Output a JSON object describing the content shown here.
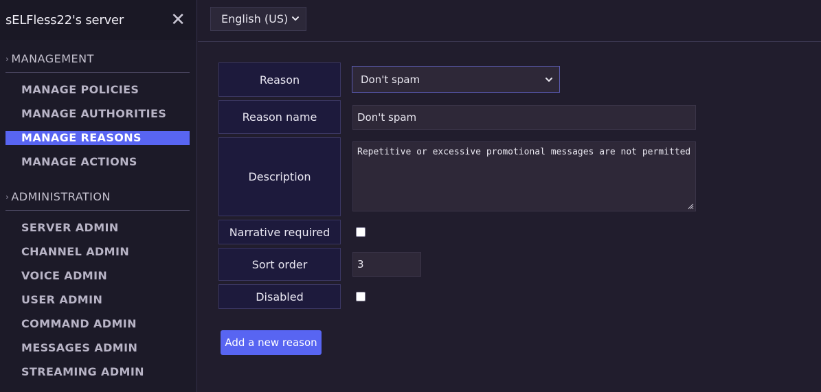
{
  "sidebar": {
    "server_name": "sELFless22's server",
    "sections": [
      {
        "title": "MANAGEMENT",
        "items": [
          "MANAGE POLICIES",
          "MANAGE AUTHORITIES",
          "MANAGE REASONS",
          "MANAGE ACTIONS"
        ]
      },
      {
        "title": "ADMINISTRATION",
        "items": [
          "SERVER ADMIN",
          "CHANNEL ADMIN",
          "VOICE ADMIN",
          "USER ADMIN",
          "COMMAND ADMIN",
          "MESSAGES ADMIN",
          "STREAMING ADMIN"
        ]
      }
    ],
    "active_item": "MANAGE REASONS"
  },
  "topbar": {
    "language": "English (US)"
  },
  "form": {
    "labels": {
      "reason": "Reason",
      "reason_name": "Reason name",
      "description": "Description",
      "narrative_required": "Narrative required",
      "sort_order": "Sort order",
      "disabled": "Disabled"
    },
    "reason_selected": "Don't spam",
    "reason_name_value": "Don't spam",
    "description_value": "Repetitive or excessive promotional messages are not permitted",
    "narrative_required_checked": false,
    "sort_order_value": "3",
    "disabled_checked": false,
    "add_button_label": "Add a new reason"
  },
  "icons": {
    "close": "close-icon",
    "language_caret": "chevron-down-icon",
    "reason_caret": "chevron-down-icon",
    "section_chevron": "chevron-right-icon"
  },
  "colors": {
    "accent": "#5865f2",
    "background": "#211d2d",
    "sidebar": "#1c1a28",
    "label_cell": "#1d1a3c"
  }
}
